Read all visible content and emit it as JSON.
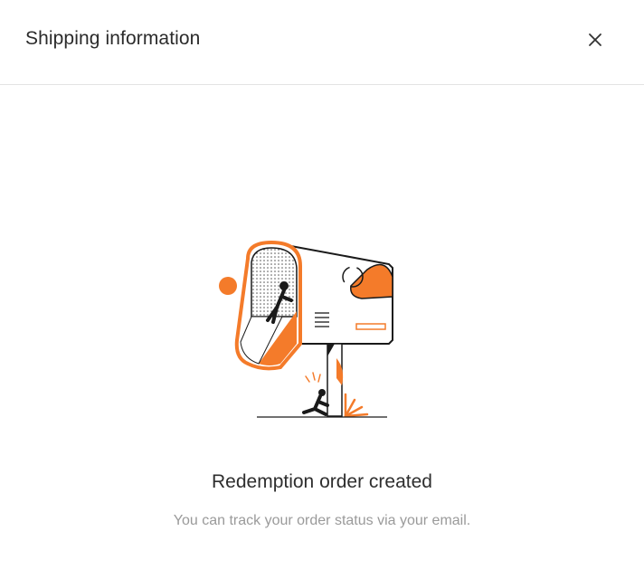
{
  "dialog": {
    "title": "Shipping information",
    "close_icon": "close-icon"
  },
  "illustration": {
    "name": "mailbox-illustration",
    "accent_color": "#F47B2A",
    "line_color": "#1a1a1a"
  },
  "status": {
    "title": "Redemption order created",
    "message": "You can track your order status via your email."
  }
}
